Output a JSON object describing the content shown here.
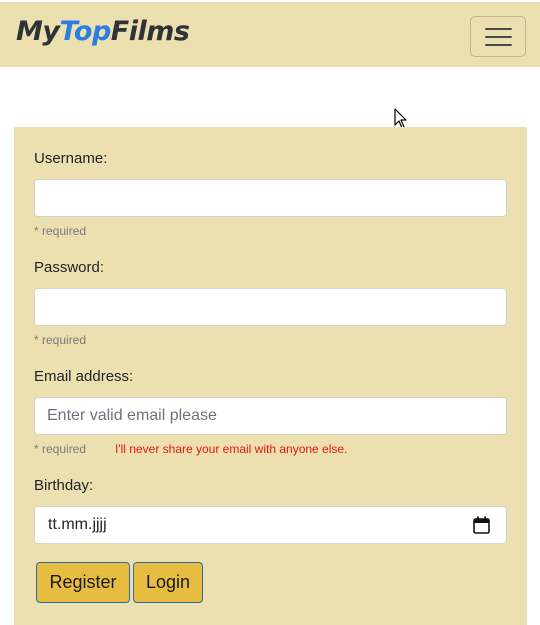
{
  "brand": {
    "part1": "My",
    "part2": "Top",
    "part3": "Films",
    "accent_color": "#2a7de1"
  },
  "navbar": {
    "menu_icon": "hamburger-menu-icon",
    "background": "#ecdfb0"
  },
  "form": {
    "username": {
      "label": "Username:",
      "value": "",
      "hint": "* required"
    },
    "password": {
      "label": "Password:",
      "value": "",
      "hint": "* required"
    },
    "email": {
      "label": "Email address:",
      "placeholder": "Enter valid email please",
      "hint": "* required",
      "note": "I'll never share your email with anyone else.",
      "note_color": "#e8180c"
    },
    "birthday": {
      "label": "Birthday:",
      "placeholder": "tt.mm.jjjj",
      "icon": "calendar-icon"
    },
    "buttons": {
      "register": "Register",
      "login": "Login",
      "color": "#e6bd41"
    }
  }
}
